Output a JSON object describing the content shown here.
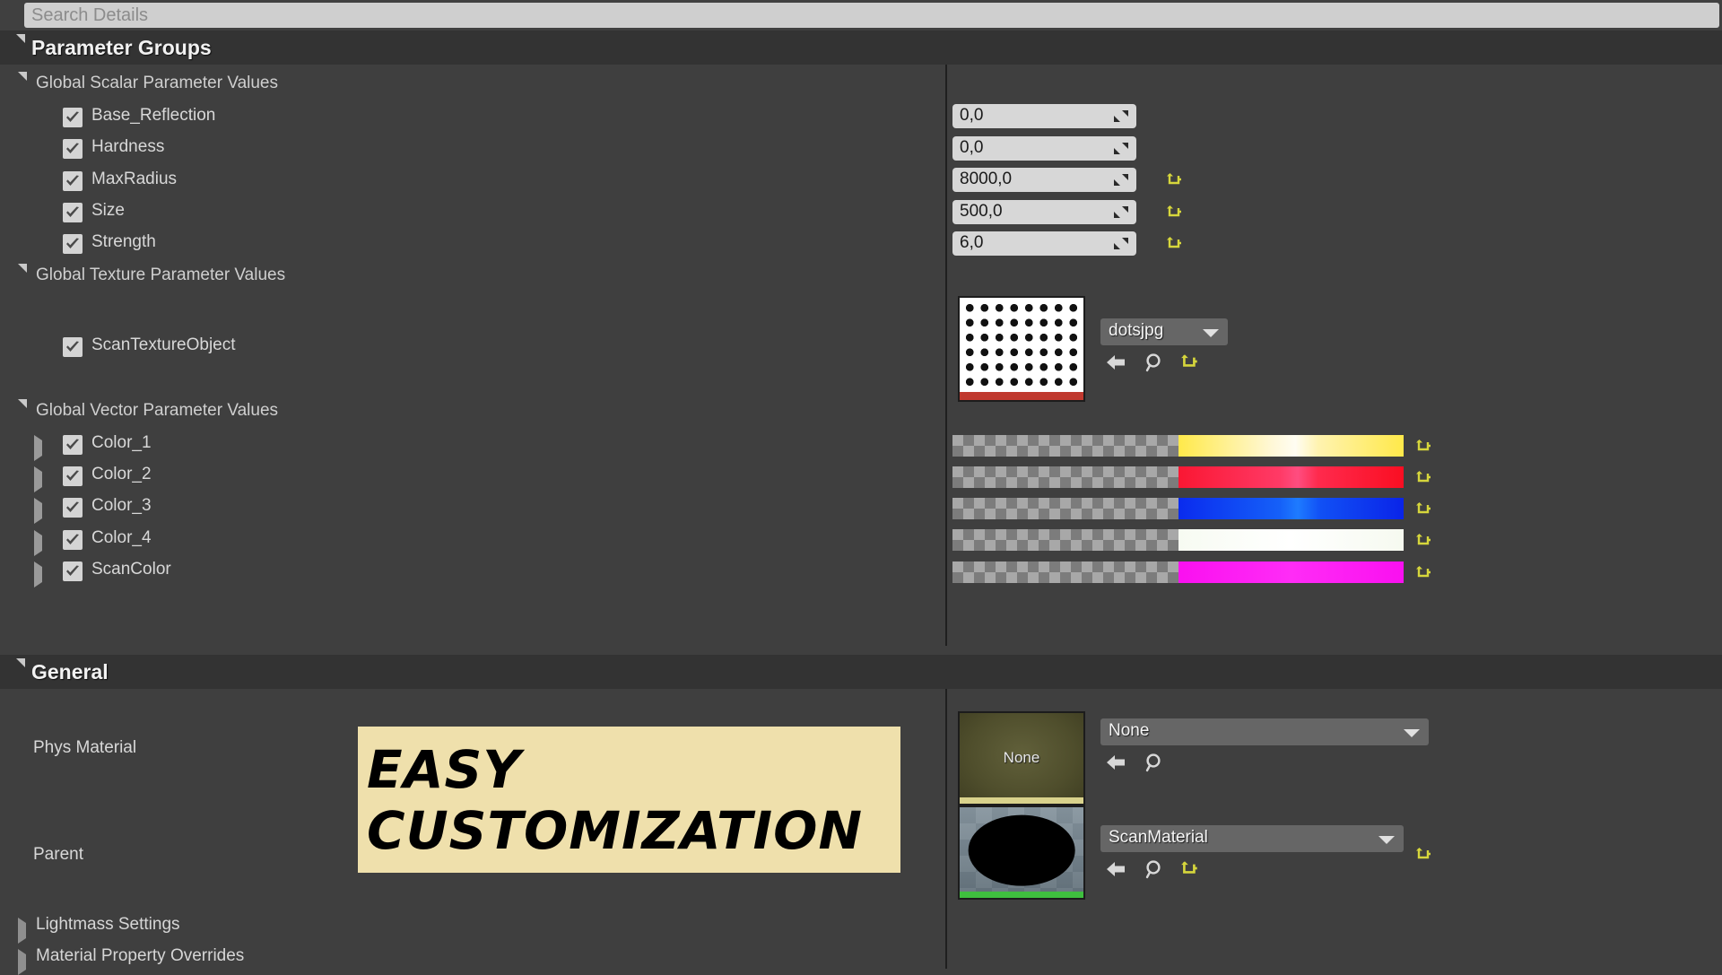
{
  "search": {
    "placeholder": "Search Details",
    "value": ""
  },
  "sections": {
    "parameter_groups": {
      "title": "Parameter Groups",
      "expanded": true
    },
    "general": {
      "title": "General",
      "expanded": true
    }
  },
  "groups": {
    "scalar": {
      "label": "Global Scalar Parameter Values"
    },
    "texture": {
      "label": "Global Texture Parameter Values"
    },
    "vector": {
      "label": "Global Vector Parameter Values"
    }
  },
  "scalar_params": [
    {
      "name": "Base_Reflection",
      "value": "0,0",
      "checked": true,
      "has_reset": false
    },
    {
      "name": "Hardness",
      "value": "0,0",
      "checked": true,
      "has_reset": false
    },
    {
      "name": "MaxRadius",
      "value": "8000,0",
      "checked": true,
      "has_reset": true
    },
    {
      "name": "Size",
      "value": "500,0",
      "checked": true,
      "has_reset": true
    },
    {
      "name": "Strength",
      "value": "6,0",
      "checked": true,
      "has_reset": true
    }
  ],
  "texture_params": [
    {
      "name": "ScanTextureObject",
      "checked": true,
      "asset_value": "dotsjpg",
      "thumbnail": "dots-texture-thumbnail",
      "has_reset": true
    }
  ],
  "vector_params": [
    {
      "name": "Color_1",
      "checked": true,
      "color": "#FFE94A",
      "has_reset": true
    },
    {
      "name": "Color_2",
      "checked": true,
      "color": "#FA1733",
      "has_reset": true
    },
    {
      "name": "Color_3",
      "checked": true,
      "color": "#0A2BEE",
      "has_reset": true
    },
    {
      "name": "Color_4",
      "checked": true,
      "color": "#FBFFF6",
      "has_reset": true
    },
    {
      "name": "ScanColor",
      "checked": true,
      "color": "#FA10F0",
      "has_reset": true
    }
  ],
  "general_fields": [
    {
      "label": "Phys Material",
      "asset_value": "None",
      "thumbnail": "none-physmaterial-thumbnail",
      "thumbnail_label": "None",
      "has_reset": false
    },
    {
      "label": "Parent",
      "asset_value": "ScanMaterial",
      "thumbnail": "scanmaterial-sphere-thumbnail",
      "thumbnail_label": "",
      "has_reset": true
    }
  ],
  "collapsed_sections": [
    {
      "label": "Lightmass Settings"
    },
    {
      "label": "Material Property Overrides"
    }
  ],
  "asset_icons": {
    "back": "back-arrow-icon",
    "browse": "magnifier-icon",
    "reset": "reset-arrow-icon",
    "dropdown": "chevron-down-icon"
  },
  "overlay_banner": {
    "line1": "EASY",
    "line2": "CUSTOMIZATION",
    "background": "#EFE0AC",
    "text_color": "#000000"
  },
  "colors": {
    "panel_bg": "#3f3f3f",
    "header_bg": "#333333",
    "input_bg": "#d7d7d7",
    "combo_bg": "#666666",
    "reset_yellow": "#d6d63c",
    "splitter": "#1f1f1f"
  }
}
